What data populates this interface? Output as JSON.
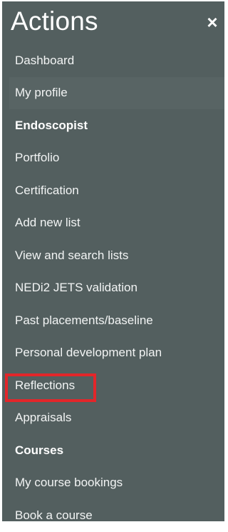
{
  "header": {
    "title": "Actions",
    "close_glyph": "×"
  },
  "menu": {
    "items": [
      {
        "label": "Dashboard",
        "kind": "link"
      },
      {
        "label": "My profile",
        "kind": "link",
        "state": "hover"
      },
      {
        "label": "Endoscopist",
        "kind": "section"
      },
      {
        "label": "Portfolio",
        "kind": "link"
      },
      {
        "label": "Certification",
        "kind": "link"
      },
      {
        "label": "Add new list",
        "kind": "link"
      },
      {
        "label": "View and search lists",
        "kind": "link"
      },
      {
        "label": "NEDi2 JETS validation",
        "kind": "link"
      },
      {
        "label": "Past placements/baseline",
        "kind": "link"
      },
      {
        "label": "Personal development plan",
        "kind": "link"
      },
      {
        "label": "Reflections",
        "kind": "link",
        "annotation": "red-outline"
      },
      {
        "label": "Appraisals",
        "kind": "link"
      },
      {
        "label": "Courses",
        "kind": "section"
      },
      {
        "label": "My course bookings",
        "kind": "link"
      },
      {
        "label": "Book a course",
        "kind": "link"
      }
    ]
  },
  "colors": {
    "panel_bg": "#535f5f",
    "hover_bg": "#586464",
    "text": "#ffffff",
    "annotation_red": "#e3262a"
  }
}
